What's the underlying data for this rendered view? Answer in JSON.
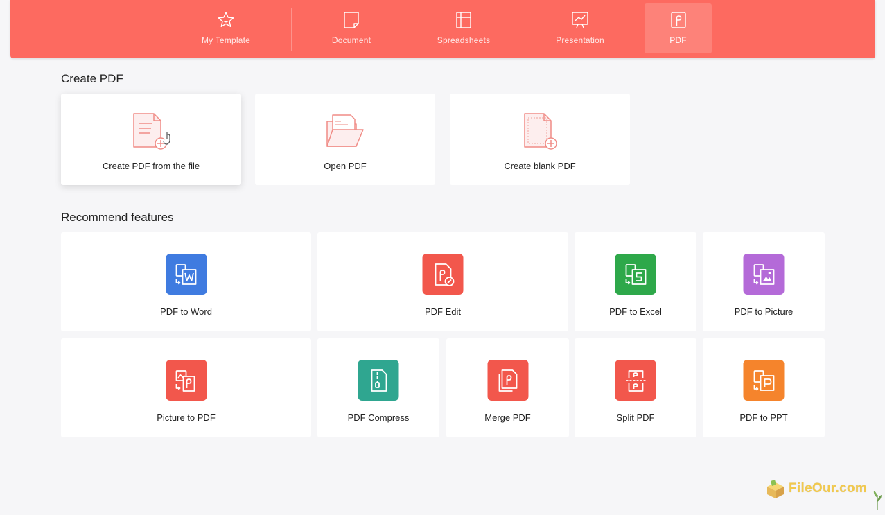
{
  "tabs": [
    {
      "label": "My Template",
      "icon": "star-icon",
      "active": false
    },
    {
      "label": "Document",
      "icon": "document-icon",
      "active": false
    },
    {
      "label": "Spreadsheets",
      "icon": "spreadsheet-icon",
      "active": false
    },
    {
      "label": "Presentation",
      "icon": "presentation-icon",
      "active": false
    },
    {
      "label": "PDF",
      "icon": "pdf-icon",
      "active": true
    }
  ],
  "create_section": {
    "title": "Create PDF",
    "items": [
      {
        "label": "Create PDF from the file",
        "icon": "file-add-icon"
      },
      {
        "label": "Open PDF",
        "icon": "open-folder-icon"
      },
      {
        "label": "Create blank PDF",
        "icon": "blank-file-add-icon"
      }
    ]
  },
  "features_section": {
    "title": "Recommend features",
    "items": [
      {
        "label": "PDF to Word",
        "icon": "pdf-to-word-icon",
        "color": "#3f7be0"
      },
      {
        "label": "PDF Edit",
        "icon": "pdf-edit-icon",
        "color": "#f2574c"
      },
      {
        "label": "PDF to Excel",
        "icon": "pdf-to-excel-icon",
        "color": "#2ea84a"
      },
      {
        "label": "PDF to Picture",
        "icon": "pdf-to-picture-icon",
        "color": "#b46ad8"
      },
      {
        "label": "Picture to PDF",
        "icon": "picture-to-pdf-icon",
        "color": "#f2574c"
      },
      {
        "label": "PDF Compress",
        "icon": "pdf-compress-icon",
        "color": "#2fa690"
      },
      {
        "label": "Merge PDF",
        "icon": "merge-pdf-icon",
        "color": "#f2574c"
      },
      {
        "label": "Split PDF",
        "icon": "split-pdf-icon",
        "color": "#f2574c"
      },
      {
        "label": "PDF to PPT",
        "icon": "pdf-to-ppt-icon",
        "color": "#f5842c"
      }
    ]
  },
  "colors": {
    "brand": "#fd6a60",
    "background": "#f6f6f8"
  },
  "watermark": {
    "text": "FileOur.com"
  }
}
